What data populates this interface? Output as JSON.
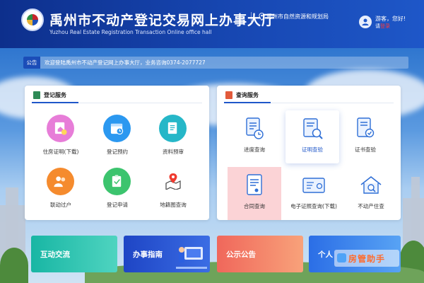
{
  "header": {
    "title": "禹州市不动产登记交易网上办事大厅",
    "subtitle": "Yuzhou Real Estate Registration Transaction Online office hall",
    "department": "禹州市自然资源和规划局",
    "greeting": "游客，您好!",
    "login_prefix": "请",
    "login_link": "登录",
    "icons": [
      "logo-emblem",
      "location-pin-icon",
      "user-avatar-icon"
    ]
  },
  "notice": {
    "badge": "公告",
    "text": "欢迎登陆禹州市不动产登记网上办事大厅，业务咨询0374-2077727"
  },
  "registration": {
    "title": "登记服务",
    "items": [
      {
        "label": "住房证明(下载)",
        "icon": "house-certificate-icon",
        "color": "#e77dd8"
      },
      {
        "label": "登记预约",
        "icon": "calendar-icon",
        "color": "#2b98f0"
      },
      {
        "label": "资料预审",
        "icon": "document-review-icon",
        "color": "#26b7c8"
      },
      {
        "label": "联动过户",
        "icon": "people-transfer-icon",
        "color": "#f58b2e"
      },
      {
        "label": "登记申请",
        "icon": "application-form-icon",
        "color": "#3cc46e"
      },
      {
        "label": "地籍图查询",
        "icon": "map-pin-icon",
        "color": "#ffffff"
      }
    ]
  },
  "query": {
    "title": "查询服务",
    "items": [
      {
        "label": "进度查询",
        "icon": "progress-doc-icon"
      },
      {
        "label": "证明查验",
        "icon": "certificate-search-icon"
      },
      {
        "label": "证书查验",
        "icon": "certificate-verify-icon"
      },
      {
        "label": "合同查询",
        "icon": "contract-icon"
      },
      {
        "label": "电子证照查询(下载)",
        "icon": "e-certificate-icon"
      },
      {
        "label": "不动产住查",
        "icon": "house-search-icon"
      }
    ]
  },
  "cards": [
    {
      "label": "互动交流",
      "color": "#18b6a4"
    },
    {
      "label": "办事指南",
      "color": "#1e45c5"
    },
    {
      "label": "公示公告",
      "color": "#f0675b"
    },
    {
      "label": "个人",
      "color": "#2b6ee6"
    }
  ],
  "watermark": "房管助手"
}
